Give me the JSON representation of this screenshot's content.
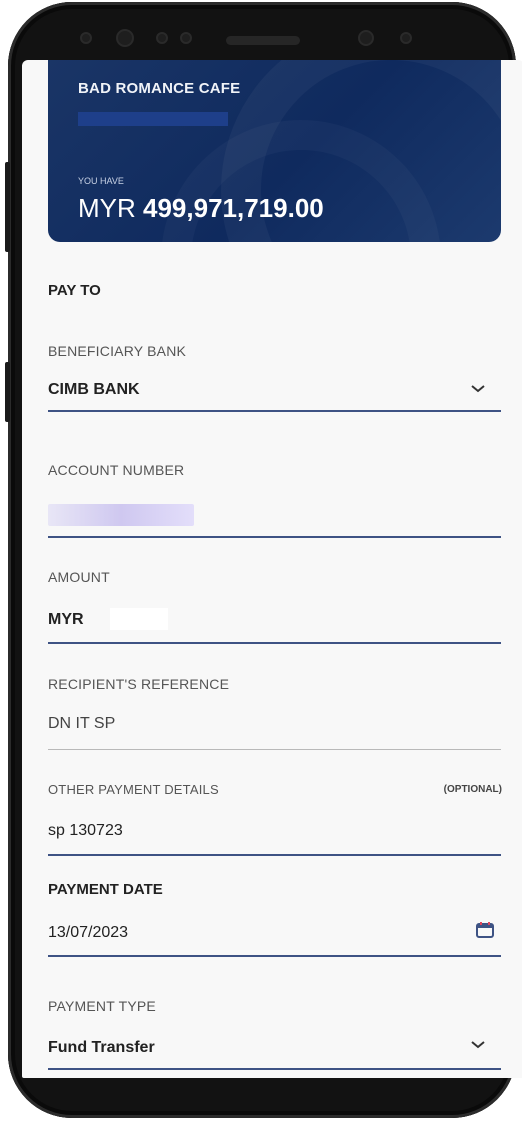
{
  "card": {
    "merchant": "BAD ROMANCE CAFE",
    "balance_label": "YOU HAVE",
    "currency": "MYR",
    "balance": "499,971,719.00"
  },
  "form": {
    "section_title": "PAY TO",
    "beneficiary_bank": {
      "label": "BENEFICIARY BANK",
      "value": "CIMB BANK",
      "icon": "chevron-down-icon"
    },
    "account_number": {
      "label": "ACCOUNT NUMBER",
      "value": ""
    },
    "amount": {
      "label": "AMOUNT",
      "currency": "MYR",
      "value": ""
    },
    "recipient_reference": {
      "label": "RECIPIENT'S REFERENCE",
      "value": "DN IT SP"
    },
    "other_payment_details": {
      "label": "OTHER PAYMENT DETAILS",
      "optional": "(OPTIONAL)",
      "value": "sp 130723"
    },
    "payment_date": {
      "label": "PAYMENT DATE",
      "value": "13/07/2023",
      "icon": "calendar-icon"
    },
    "payment_type": {
      "label": "PAYMENT TYPE",
      "value": "Fund Transfer",
      "icon": "chevron-down-icon"
    }
  },
  "colors": {
    "card_background": "#0f2a5e",
    "underline_active": "#3e5384",
    "underline_inactive": "#b9b9b9",
    "screen_background": "#f8f8f8"
  }
}
